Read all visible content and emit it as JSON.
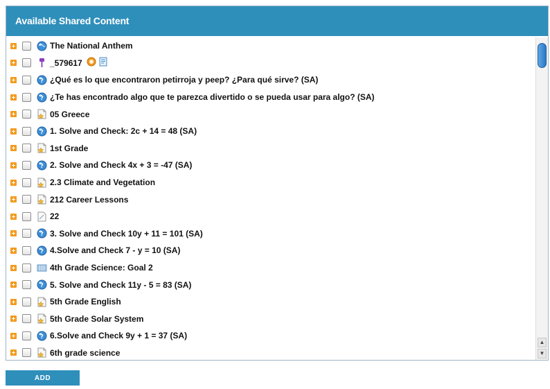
{
  "panel": {
    "title": "Available Shared Content",
    "items": [
      {
        "label": "The National Anthem",
        "icon": "globe-icon"
      },
      {
        "label": "_579617",
        "icon": "pin-icon",
        "extras": [
          "badge-icon",
          "page-icon"
        ]
      },
      {
        "label": "¿Qué es lo que encontraron petirroja y peep? ¿Para qué sirve? (SA)",
        "icon": "question-globe-icon"
      },
      {
        "label": "¿Te has encontrado algo que te parezca divertido o se pueda usar para algo? (SA)",
        "icon": "question-globe-icon"
      },
      {
        "label": "05 Greece",
        "icon": "lesson-icon"
      },
      {
        "label": "1. Solve and Check: 2c + 14 = 48 (SA)",
        "icon": "question-globe-icon"
      },
      {
        "label": "1st Grade",
        "icon": "lesson-icon"
      },
      {
        "label": "2. Solve and Check 4x + 3 = -47 (SA)",
        "icon": "question-globe-icon"
      },
      {
        "label": "2.3 Climate and Vegetation",
        "icon": "lesson-icon"
      },
      {
        "label": "212 Career Lessons",
        "icon": "lesson-icon"
      },
      {
        "label": "22",
        "icon": "document-icon"
      },
      {
        "label": "3. Solve and Check 10y + 11 = 101 (SA)",
        "icon": "question-globe-icon"
      },
      {
        "label": "4.Solve and Check 7 - y = 10 (SA)",
        "icon": "question-globe-icon"
      },
      {
        "label": "4th Grade Science: Goal 2",
        "icon": "goal-icon"
      },
      {
        "label": "5. Solve and Check 11y - 5 = 83 (SA)",
        "icon": "question-globe-icon"
      },
      {
        "label": "5th Grade English",
        "icon": "lesson-icon"
      },
      {
        "label": "5th Grade Solar System",
        "icon": "lesson-icon"
      },
      {
        "label": "6.Solve and Check 9y + 1 = 37 (SA)",
        "icon": "question-globe-icon"
      },
      {
        "label": "6th grade science",
        "icon": "lesson-icon"
      }
    ]
  },
  "scroll": {
    "up": "▲",
    "down": "▼"
  },
  "add_button": {
    "label": "ADD"
  },
  "colors": {
    "header": "#2f8fbb",
    "expand": "#f39a1e",
    "button": "#2f8fbb"
  }
}
